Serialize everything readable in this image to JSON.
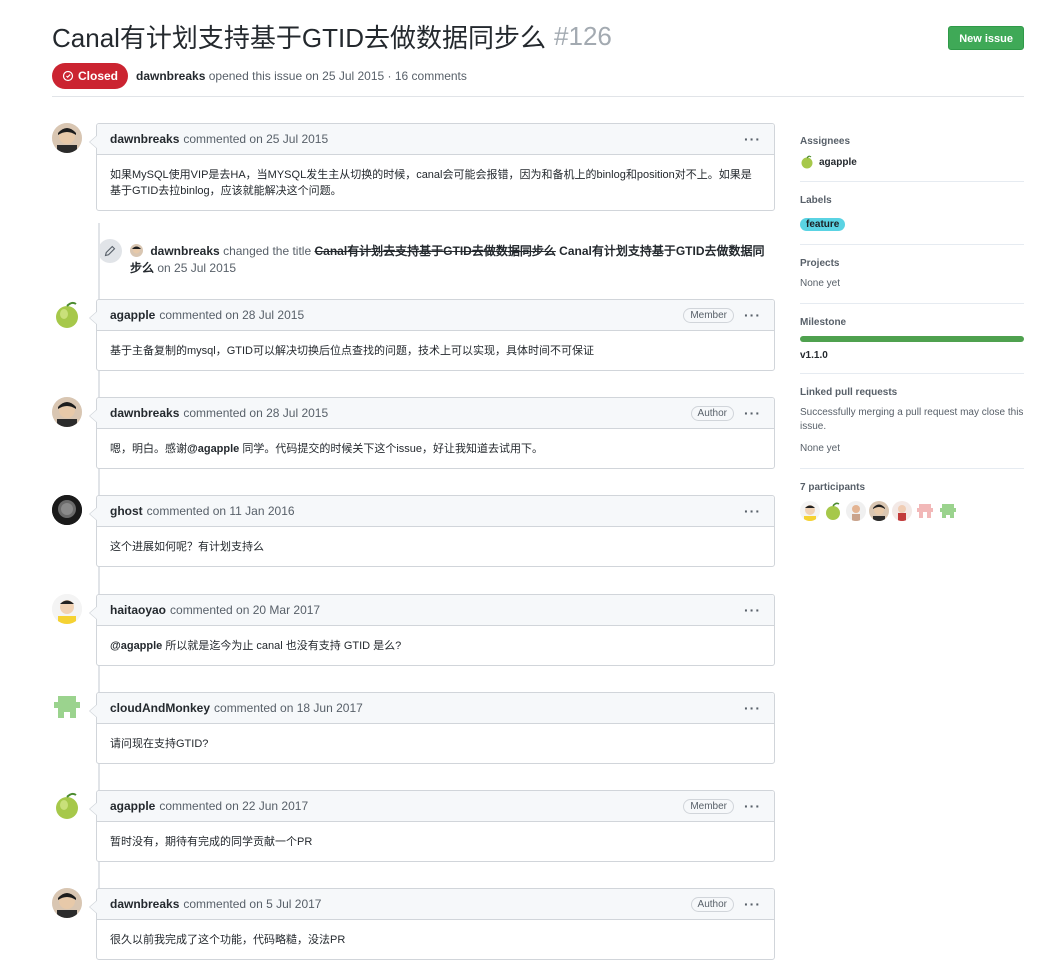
{
  "issue": {
    "title": "Canal有计划支持基于GTID去做数据同步么",
    "number": "#126",
    "state": "Closed",
    "opened_by": "dawnbreaks",
    "meta_tail": "opened this issue on 25 Jul 2015 · 16 comments",
    "new_issue_label": "New issue"
  },
  "comments": [
    {
      "author": "dawnbreaks",
      "when": "commented on 25 Jul 2015",
      "role": "",
      "body": "如果MySQL使用VIP是去HA，当MYSQL发生主从切换的时候，canal会可能会报错，因为和备机上的binlog和position对不上。如果是基于GTID去拉binlog，应该就能解决这个问题。"
    },
    {
      "author": "agapple",
      "when": "commented on 28 Jul 2015",
      "role": "Member",
      "body": "基于主备复制的mysql，GTID可以解决切换后位点查找的问题，技术上可以实现，具体时间不可保证"
    },
    {
      "author": "dawnbreaks",
      "when": "commented on 28 Jul 2015",
      "role": "Author",
      "body_pre": "嗯，明白。感谢",
      "mention": "@agapple",
      "body_post": " 同学。代码提交的时候关下这个issue，好让我知道去试用下。"
    },
    {
      "author": "ghost",
      "when": "commented on 11 Jan 2016",
      "role": "",
      "body": "这个进展如何呢？有计划支持么"
    },
    {
      "author": "haitaoyao",
      "when": "commented on 20 Mar 2017",
      "role": "",
      "mention": "@agapple",
      "body_post": " 所以就是迄今为止 canal 也没有支持 GTID 是么?"
    },
    {
      "author": "cloudAndMonkey",
      "when": "commented on 18 Jun 2017",
      "role": "",
      "body": "请问现在支持GTID?"
    },
    {
      "author": "agapple",
      "when": "commented on 22 Jun 2017",
      "role": "Member",
      "body": "暂时没有，期待有完成的同学贡献一个PR"
    },
    {
      "author": "dawnbreaks",
      "when": "commented on 5 Jul 2017",
      "role": "Author",
      "body": "很久以前我完成了这个功能，代码略糙，没法PR"
    }
  ],
  "rename_event": {
    "actor": "dawnbreaks",
    "verb": "changed the title",
    "old_title": "Canal有计划去支持基于GTID去做数据同步么",
    "new_title": "Canal有计划支持基于GTID去做数据同步么",
    "when": "on 25 Jul 2015"
  },
  "sidebar": {
    "assignees_title": "Assignees",
    "assignee": "agapple",
    "labels_title": "Labels",
    "label": "feature",
    "label_color": "#5ad3e3",
    "projects_title": "Projects",
    "projects_value": "None yet",
    "milestone_title": "Milestone",
    "milestone_name": "v1.1.0",
    "milestone_progress": 1.0,
    "linked_title": "Linked pull requests",
    "linked_desc": "Successfully merging a pull request may close this issue.",
    "linked_value": "None yet",
    "participants_title": "7 participants"
  },
  "colors": {
    "closed_red": "#cb2431",
    "new_issue_green": "#3fa957",
    "milestone_green": "#4fa14f"
  }
}
